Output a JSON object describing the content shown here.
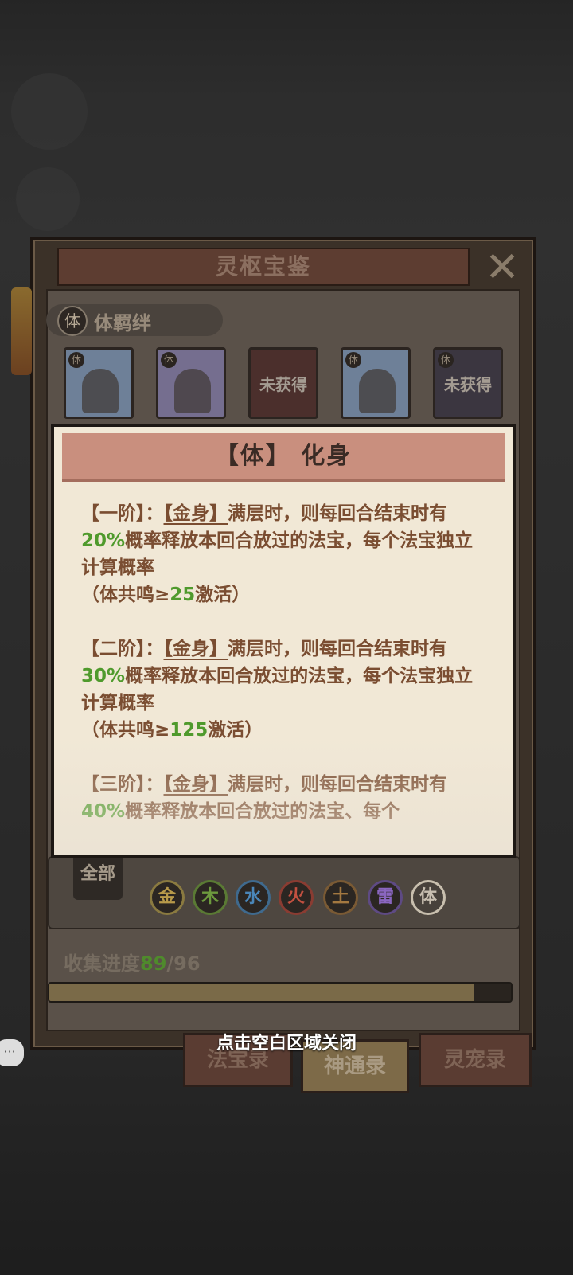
{
  "panel": {
    "title": "灵枢宝鉴",
    "close": "✕"
  },
  "bond": {
    "badge": "体",
    "label": "体羁绊"
  },
  "cards": [
    {
      "tag": "体",
      "locked": ""
    },
    {
      "tag": "体",
      "locked": ""
    },
    {
      "tag": "",
      "locked": "未获得"
    },
    {
      "tag": "体",
      "locked": ""
    },
    {
      "tag": "体",
      "locked": "未获得"
    }
  ],
  "tooltip": {
    "title": "【体】 化身",
    "tiers": [
      {
        "prefix": "【一阶】：",
        "item": "【金身】",
        "text1": "满层时，则每回合结束时有",
        "pct": "20%",
        "text2": "概率释放本回合放过的法宝，每个法宝独立计算概率",
        "act_prefix": "（体共鸣≥",
        "act_num": "25",
        "act_suffix": "激活）"
      },
      {
        "prefix": "【二阶】：",
        "item": "【金身】",
        "text1": "满层时，则每回合结束时有",
        "pct": "30%",
        "text2": "概率释放本回合放过的法宝，每个法宝独立计算概率",
        "act_prefix": "（体共鸣≥",
        "act_num": "125",
        "act_suffix": "激活）"
      },
      {
        "prefix": "【三阶】：",
        "item": "【金身】",
        "text1": "满层时，则每回合结束时有",
        "pct": "40%",
        "text2": "概率释放本回合放过的法宝、每个",
        "act_prefix": "",
        "act_num": "",
        "act_suffix": ""
      }
    ]
  },
  "filter": {
    "all": "全部",
    "elements": [
      {
        "label": "金",
        "color": "#b89a4a"
      },
      {
        "label": "木",
        "color": "#6d9a3e"
      },
      {
        "label": "水",
        "color": "#4a86b8"
      },
      {
        "label": "火",
        "color": "#b84a3a"
      },
      {
        "label": "土",
        "color": "#a37840"
      },
      {
        "label": "雷",
        "color": "#7a56b0"
      },
      {
        "label": "体",
        "color": "#c7beb0"
      }
    ]
  },
  "progress": {
    "label": "收集进度",
    "current": "89",
    "total": "/96",
    "fraction": 0.92
  },
  "hint": "点击空白区域关闭",
  "tabs": [
    "法宝录",
    "神通录",
    "灵宠录"
  ],
  "chat": "···"
}
